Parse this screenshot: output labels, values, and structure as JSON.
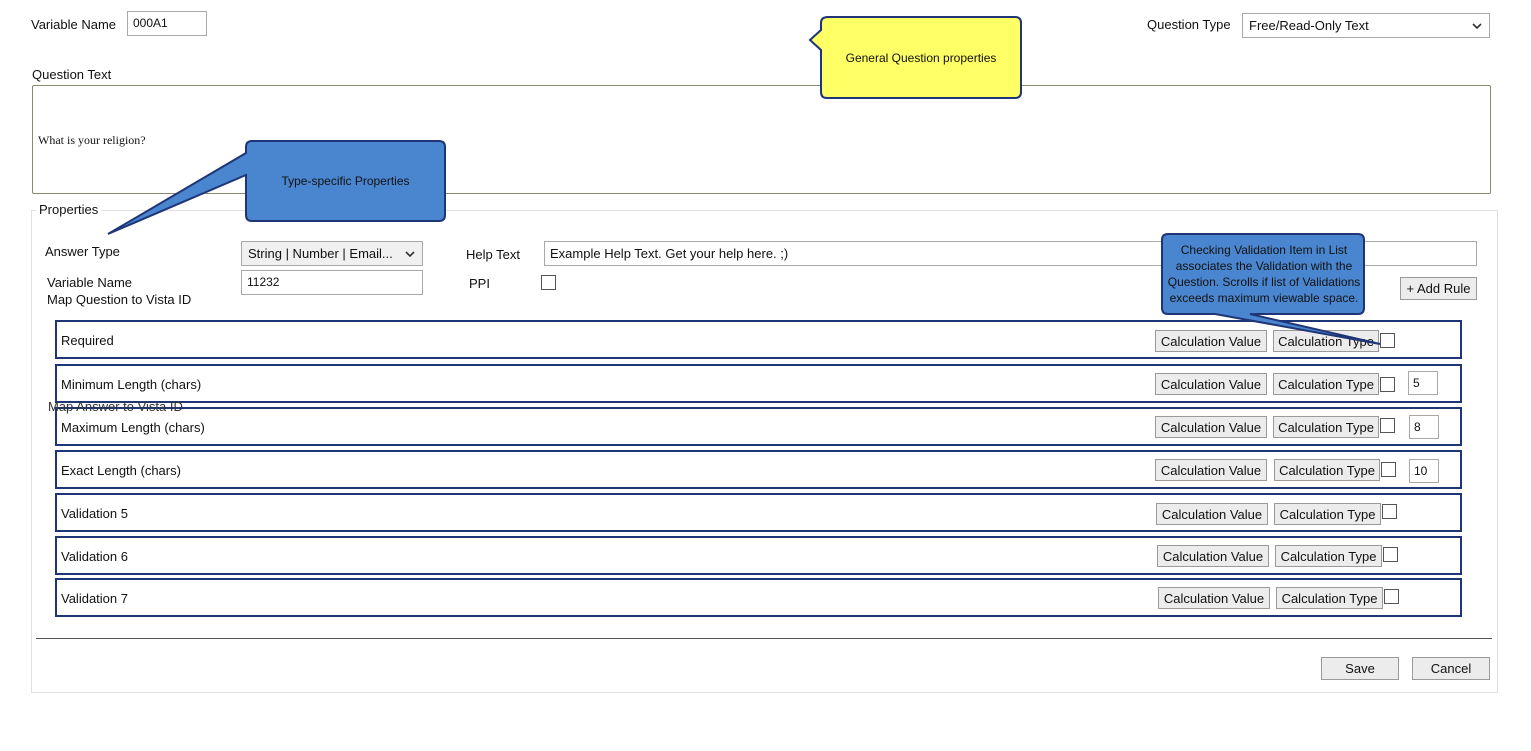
{
  "header": {
    "variable_name_label": "Variable Name",
    "variable_name_value": "000A1",
    "question_type_label": "Question Type",
    "question_type_value": "Free/Read-Only Text"
  },
  "question": {
    "label": "Question Text",
    "text": "What is your religion?"
  },
  "properties": {
    "legend": "Properties",
    "answer_type_label": "Answer Type",
    "answer_type_value": "String | Number | Email...",
    "help_text_label": "Help Text",
    "help_text_value": "Example Help Text.  Get your help here. ;)",
    "variable_name_label": "Variable Name",
    "variable_name_value": "11232",
    "map_question_label": "Map Question to Vista ID",
    "ppi_label": "PPI",
    "add_rule_label": "+ Add Rule",
    "map_answer_label": "Map Answer to Vista ID"
  },
  "rules": [
    {
      "label": "Required",
      "calc_value": "Calculation Value",
      "calc_type": "Calculation Type",
      "value": ""
    },
    {
      "label": "Minimum Length (chars)",
      "calc_value": "Calculation Value",
      "calc_type": "Calculation Type",
      "value": "5"
    },
    {
      "label": "Maximum Length (chars)",
      "calc_value": "Calculation Value",
      "calc_type": "Calculation Type",
      "value": "8"
    },
    {
      "label": "Exact Length (chars)",
      "calc_value": "Calculation Value",
      "calc_type": "Calculation Type",
      "value": "10"
    },
    {
      "label": "Validation 5",
      "calc_value": "Calculation Value",
      "calc_type": "Calculation Type",
      "value": ""
    },
    {
      "label": "Validation 6",
      "calc_value": "Calculation Value",
      "calc_type": "Calculation Type",
      "value": ""
    },
    {
      "label": "Validation 7",
      "calc_value": "Calculation Value",
      "calc_type": "Calculation Type",
      "value": ""
    }
  ],
  "footer": {
    "save_label": "Save",
    "cancel_label": "Cancel"
  },
  "callouts": {
    "general": "General Question properties",
    "type_specific": "Type-specific Properties",
    "validation_note": "Checking Validation Item in List associates the Validation with the Question.  Scrolls if list of Validations exceeds maximum viewable space."
  },
  "colors": {
    "callout_yellow": "#ffff66",
    "callout_blue": "#4a86cf",
    "rule_border": "#1f3576"
  },
  "icons": {
    "dropdown": "chevron-down-icon"
  }
}
